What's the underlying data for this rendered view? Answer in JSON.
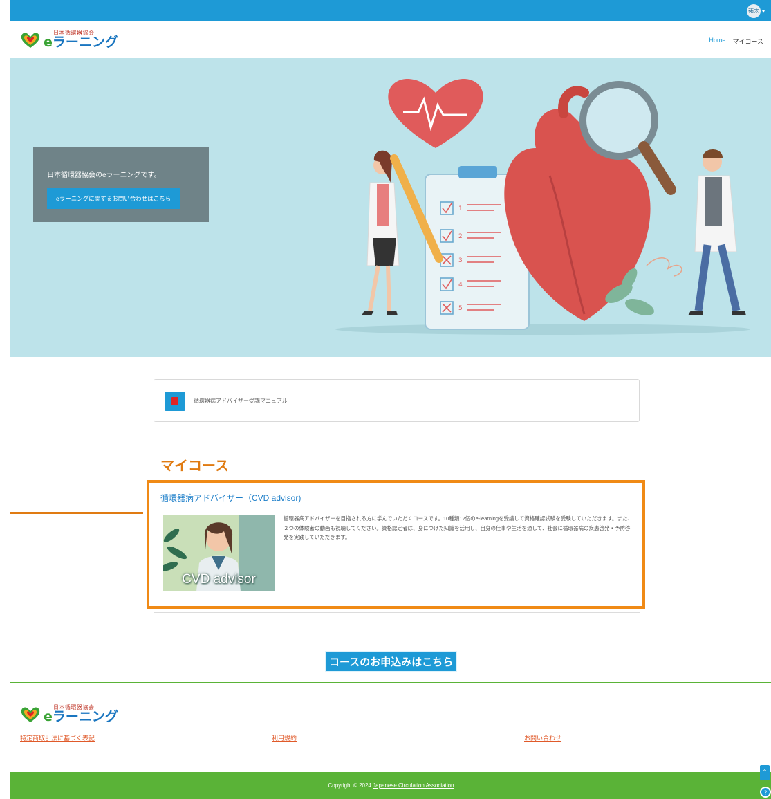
{
  "topbar": {
    "user_badge": "祐太",
    "user_caret": "▾"
  },
  "header": {
    "logo_small": "日本循環器協会",
    "logo_big_e": "e",
    "logo_big_rest": "ラーニング",
    "nav": {
      "home": "Home",
      "mycourse": "マイコース"
    }
  },
  "hero": {
    "text": "日本循環器協会のeラーニングです。",
    "button": "eラーニングに関するお問い合わせはこちら",
    "checklist": [
      "1",
      "2",
      "3",
      "4",
      "5"
    ]
  },
  "manual": {
    "label": "循環器病アドバイザー受講マニュアル"
  },
  "mycourse": {
    "title": "マイコース",
    "course": {
      "title": "循環器病アドバイザー（CVD advisor)",
      "thumbnail_label": "CVD advisor",
      "description": "循環器病アドバイザーを目指される方に学んでいただくコースです。10種類12個のe-learningを受講して資格確認試験を受験していただきます。また、２つの体験者の動画も視聴してください。資格認定者は、身につけた知識を活用し、自身の仕事や生活を通して、社会に循環器病の疾患啓発・予防啓発を実践していただきます。"
    }
  },
  "apply_button": "コースのお申込みはこちら",
  "footer": {
    "links": [
      "特定商取引法に基づく表記",
      "利用規約",
      "お問い合わせ"
    ],
    "copyright_prefix": "Copyright © 2024 ",
    "copyright_link": "Japanese Circulation Association"
  },
  "colors": {
    "brand_blue": "#1e9ad6",
    "accent_orange": "#f08a16",
    "footer_green": "#5ab337",
    "hero_bg": "#bde3ea"
  },
  "icons": {
    "scroll_top": "^",
    "help": "?"
  }
}
